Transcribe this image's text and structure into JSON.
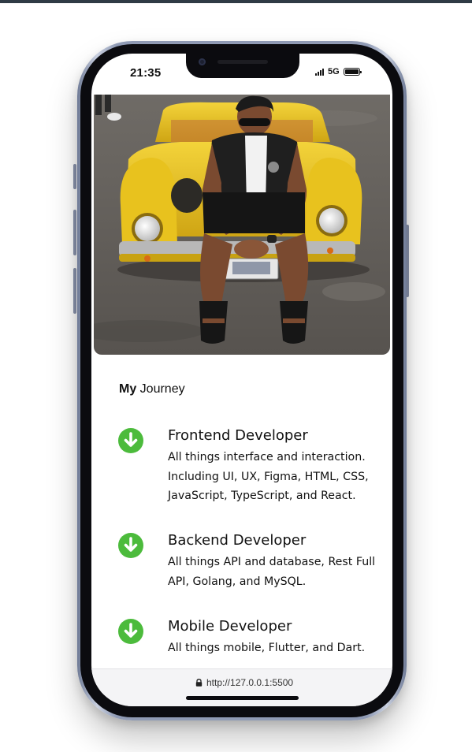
{
  "status_bar": {
    "time": "21:35",
    "network": "5G"
  },
  "journey": {
    "heading_bold": "My",
    "heading_rest": " Journey",
    "items": [
      {
        "title": "Frontend Developer",
        "description": "All things interface and interaction. Including UI, UX, Figma, HTML, CSS, JavaScript, TypeScript, and React."
      },
      {
        "title": "Backend Developer",
        "description": "All things API and database, Rest Full API, Golang, and MySQL."
      },
      {
        "title": "Mobile Developer",
        "description": "All things mobile, Flutter, and Dart."
      }
    ]
  },
  "browser": {
    "url": "http://127.0.0.1:5500"
  },
  "colors": {
    "accent_green": "#4cbb3c",
    "phone_frame": "#8f9ab4",
    "top_strip": "#2f3b45"
  },
  "icons": {
    "item_icon": "arrow-down-circle-icon",
    "url_icon": "lock-icon"
  }
}
